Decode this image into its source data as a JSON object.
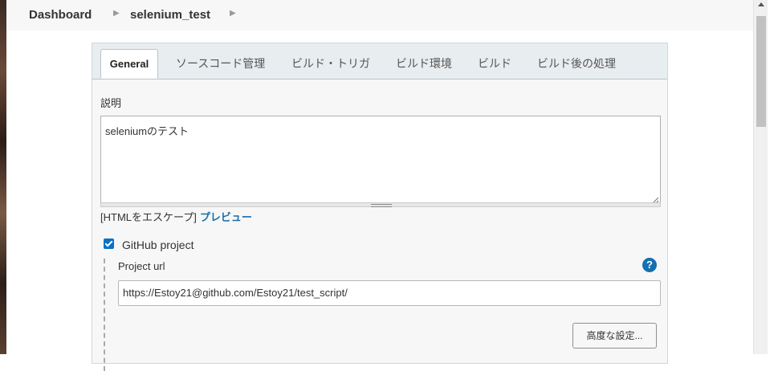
{
  "breadcrumb": {
    "items": [
      "Dashboard",
      "selenium_test"
    ]
  },
  "tabs": [
    "General",
    "ソースコード管理",
    "ビルド・トリガ",
    "ビルド環境",
    "ビルド",
    "ビルド後の処理"
  ],
  "description": {
    "label": "説明",
    "value": "seleniumのテスト",
    "escape_note": "[HTMLをエスケープ]",
    "preview_link": "プレビュー"
  },
  "github_project": {
    "label": "GitHub project",
    "checked": true,
    "project_url_label": "Project url",
    "project_url_value": "https://Estoy21@github.com/Estoy21/test_script/",
    "help_icon": "?",
    "advanced_button": "高度な設定..."
  },
  "colors": {
    "link": "#1a6ea8",
    "checkbox": "#0b70c8",
    "help": "#1470b0"
  }
}
